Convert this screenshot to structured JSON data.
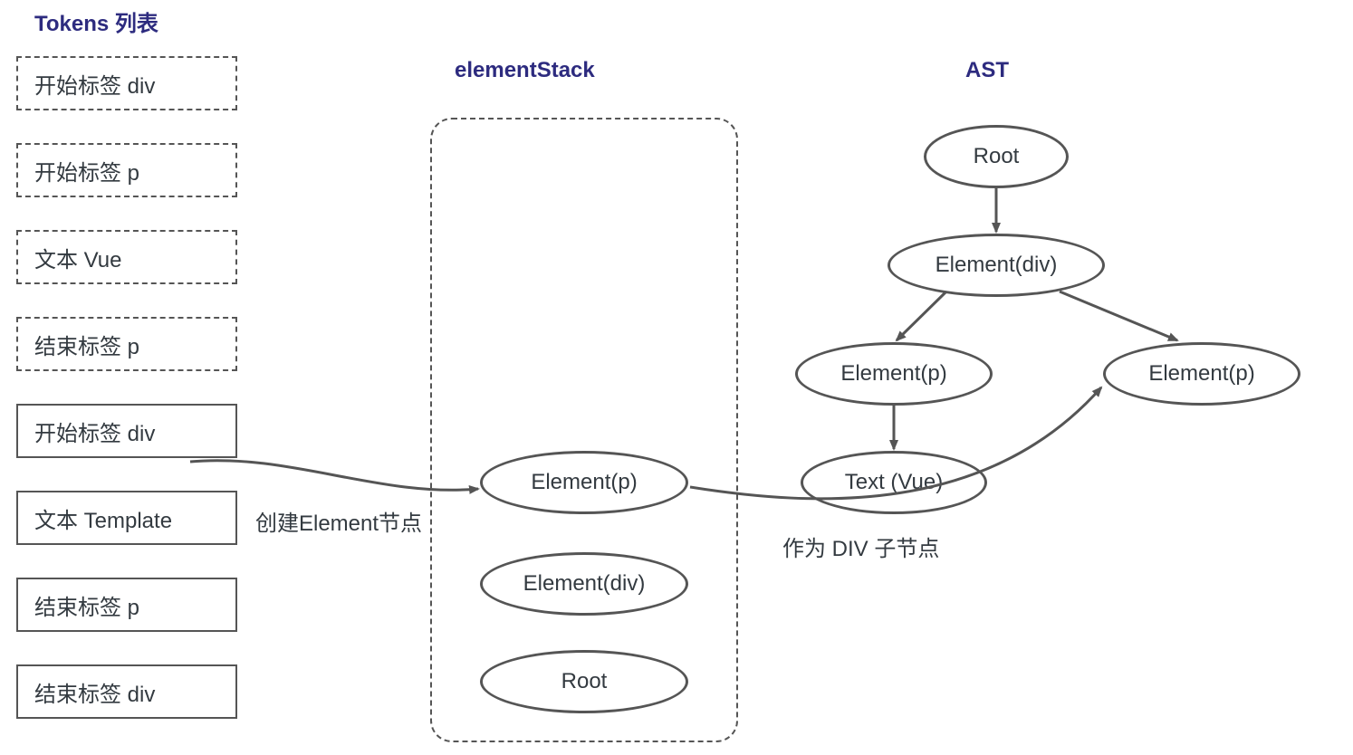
{
  "titles": {
    "tokens": "Tokens 列表",
    "stack": "elementStack",
    "ast": "AST"
  },
  "tokens": [
    {
      "label": "开始标签 div",
      "style": "dashed"
    },
    {
      "label": "开始标签 p",
      "style": "dashed"
    },
    {
      "label": "文本 Vue",
      "style": "dashed"
    },
    {
      "label": "结束标签 p",
      "style": "dashed"
    },
    {
      "label": "开始标签 div",
      "style": "solid"
    },
    {
      "label": "文本 Template",
      "style": "solid"
    },
    {
      "label": "结束标签 p",
      "style": "solid"
    },
    {
      "label": "结束标签 div",
      "style": "solid"
    }
  ],
  "stack": {
    "items": [
      "Element(p)",
      "Element(div)",
      "Root"
    ]
  },
  "ast": {
    "root": "Root",
    "div": "Element(div)",
    "p1": "Element(p)",
    "p2": "Element(p)",
    "text": "Text (Vue)"
  },
  "annotations": {
    "createElement": "创建Element节点",
    "asDivChild": "作为 DIV 子节点"
  }
}
